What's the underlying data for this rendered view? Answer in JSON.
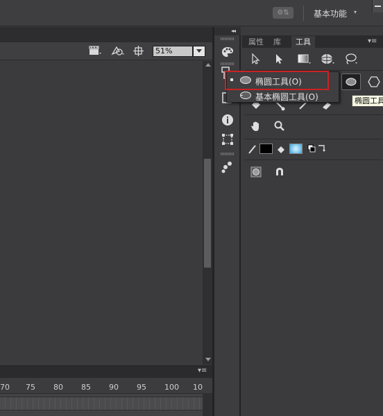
{
  "topbar": {
    "sync_icon": "sync-settings-icon",
    "workspace_label": "基本功能",
    "workspace_caret": "▾"
  },
  "stage_toolbar": {
    "zoom_value": "51%"
  },
  "timeline": {
    "menu_icon": "▾≡",
    "ruler_numbers": [
      "70",
      "75",
      "80",
      "85",
      "90",
      "95",
      "100",
      "10"
    ]
  },
  "icon_strip": {
    "collapse_label": "◂◂",
    "icons": [
      "palette-icon",
      "align-icon",
      "info-icon",
      "transform-icon",
      "components-icon"
    ]
  },
  "panel": {
    "tabs": [
      "属性",
      "库",
      "工具"
    ],
    "active_tab": "工具",
    "menu_icon": "▾≡"
  },
  "flyout": {
    "items": [
      {
        "label": "椭圆工具(O)",
        "selected": true
      },
      {
        "label": "基本椭圆工具(O)",
        "selected": false
      }
    ]
  },
  "tooltip": {
    "text": "椭圆工具"
  },
  "colors": {
    "stroke": "#000000",
    "fill_gradient": "#8fd0f2",
    "highlight_border": "#cc2222"
  }
}
